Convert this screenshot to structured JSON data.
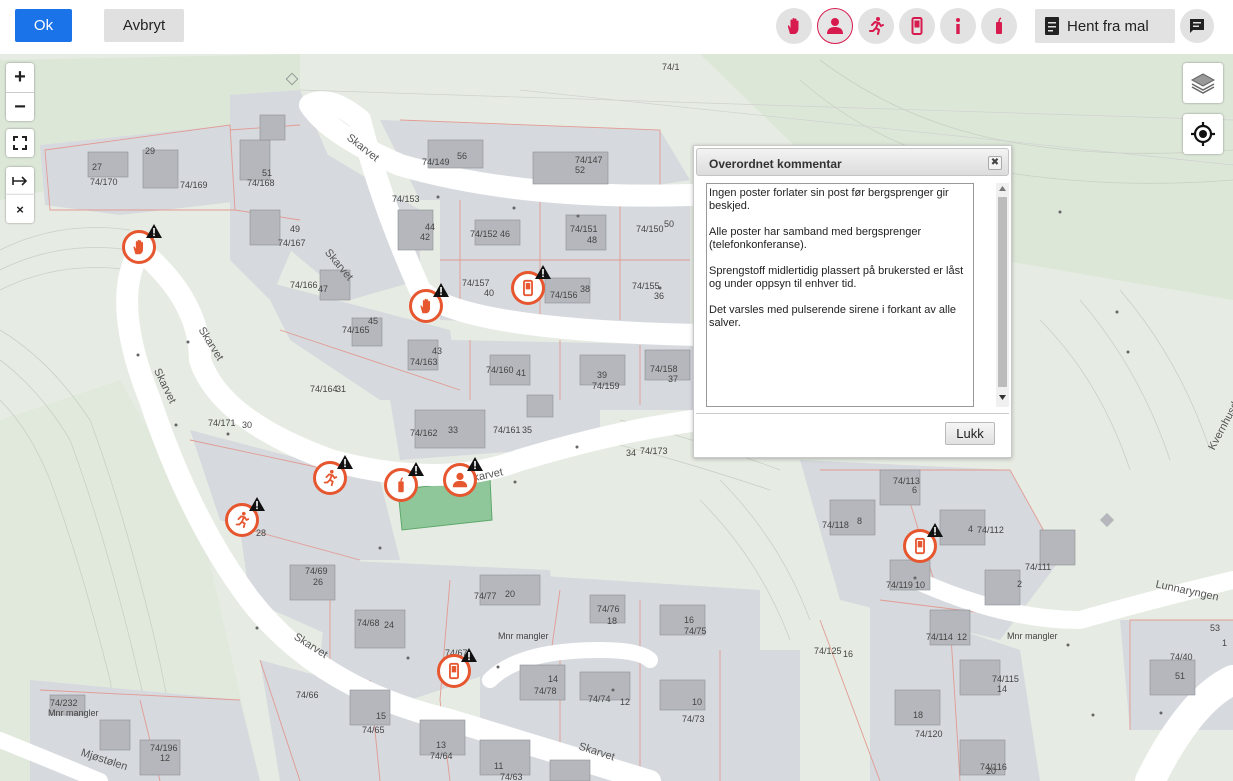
{
  "toolbar": {
    "ok_label": "Ok",
    "cancel_label": "Avbryt",
    "template_label": "Hent fra mal"
  },
  "post_types": [
    "hand-stop-icon",
    "person-guard-icon",
    "running-person-icon",
    "mobile-phone-icon",
    "info-icon",
    "explosive-stick-icon"
  ],
  "map_controls": {
    "zoom_in": "+",
    "zoom_out": "−",
    "close_symbol": "×"
  },
  "roads": {
    "r1": "Skarvet",
    "r2": "Skarvet",
    "r3": "Skarvet",
    "r4": "Skarvet",
    "r5": "Skarvet",
    "r6": "Skarvet",
    "r7": "Skarvet",
    "r8": "Lunnaryngen",
    "r9": "Kvernhusdalen",
    "r10": "Mjøstølen"
  },
  "map_labels": {
    "l1": "74/1",
    "l2": "27",
    "l3": "74/170",
    "l4": "29",
    "l5": "74/169",
    "l6": "51",
    "l7": "74/168",
    "l8": "74/149",
    "l9": "56",
    "l10": "74/147",
    "l11": "52",
    "l12": "74/153",
    "l13": "44",
    "l14": "42",
    "l15": "74/152",
    "l16": "46",
    "l17": "74/151",
    "l18": "48",
    "l19": "74/150",
    "l20": "50",
    "l21": "49",
    "l22": "74/167",
    "l23": "74/166",
    "l24": "47",
    "l25": "74/165",
    "l26": "45",
    "l27": "74/157",
    "l28": "40",
    "l29": "74/156",
    "l30": "38",
    "l31": "74/155",
    "l32": "36",
    "l33": "43",
    "l34": "74/163",
    "l35": "74/160",
    "l36": "41",
    "l37": "39",
    "l38": "74/159",
    "l39": "74/158",
    "l40": "37",
    "l41": "74/164",
    "l42": "31",
    "l43": "74/171",
    "l44": "30",
    "l45": "74/162",
    "l46": "33",
    "l47": "74/161",
    "l48": "35",
    "l49": "34",
    "l50": "74/173",
    "l51": "28",
    "l52": "74/69",
    "l53": "26",
    "l54": "74/68",
    "l55": "24",
    "l56": "74/77",
    "l57": "20",
    "l58": "74/76",
    "l59": "18",
    "l60": "16",
    "l61": "74/75",
    "l62": "Mnr mangler",
    "l63": "74/67",
    "l64": "14",
    "l65": "74/78",
    "l66": "74/74",
    "l67": "12",
    "l68": "10",
    "l69": "74/73",
    "l70": "74/66",
    "l71": "74/232",
    "l72": "Mnr mangler",
    "l73": "15",
    "l74": "74/65",
    "l75": "13",
    "l76": "74/64",
    "l77": "11",
    "l78": "74/63",
    "l79": "74/196",
    "l80": "12",
    "l81": "74/113",
    "l82": "6",
    "l83": "74/118",
    "l84": "8",
    "l85": "4",
    "l86": "74/112",
    "l87": "74/111",
    "l88": "2",
    "l89": "74/119",
    "l90": "10",
    "l91": "74/114",
    "l92": "12",
    "l93": "Mnr mangler",
    "l94": "74/125",
    "l95": "16",
    "l96": "74/115",
    "l97": "14",
    "l98": "18",
    "l99": "74/120",
    "l100": "74/116",
    "l101": "20",
    "l102": "53",
    "l103": "74/40",
    "l104": "51",
    "l105": "1"
  },
  "dialog": {
    "title": "Overordnet kommentar",
    "close": "✖",
    "text": "Ingen poster forlater sin post før bergsprenger gir beskjed.\n\nAlle poster har samband med bergsprenger (telefonkonferanse).\n\nSprengstoff midlertidig plassert på brukersted er låst og under oppsyn til enhver tid.\n\nDet varsles med pulserende sirene i forkant av alle salver.",
    "button": "Lukk"
  },
  "colors": {
    "accent": "#1a73e8",
    "post_red": "#e6562f",
    "icon_red": "#d81b4f"
  }
}
